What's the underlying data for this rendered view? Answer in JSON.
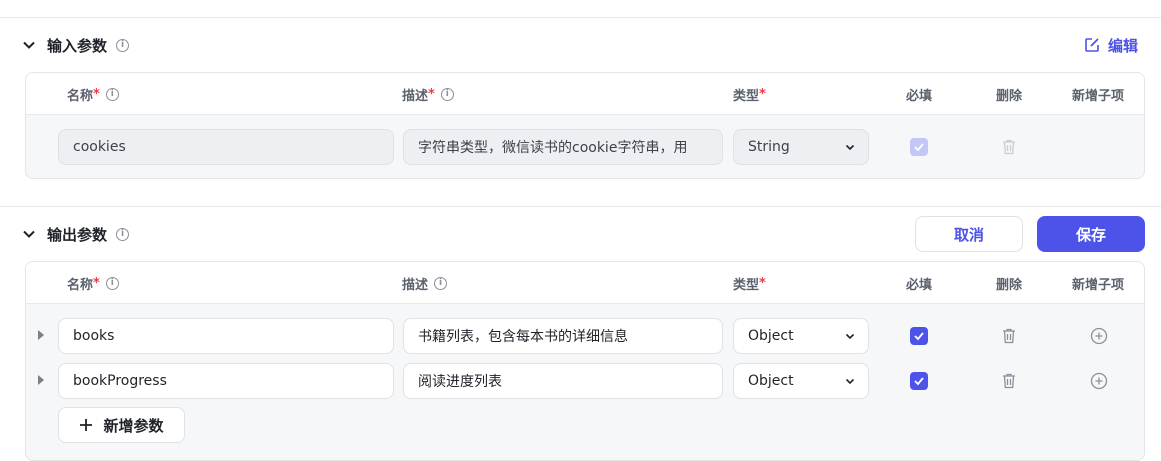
{
  "input_section": {
    "title": "输入参数",
    "edit_label": "编辑",
    "columns": {
      "name": "名称",
      "desc": "描述",
      "type": "类型",
      "required": "必填",
      "delete": "删除",
      "add_child": "新增子项",
      "required_mark": "*"
    },
    "rows": [
      {
        "name": "cookies",
        "desc": "字符串类型，微信读书的cookie字符串，用",
        "type": "String",
        "required": true
      }
    ]
  },
  "output_section": {
    "title": "输出参数",
    "cancel_label": "取消",
    "save_label": "保存",
    "columns": {
      "name": "名称",
      "desc": "描述",
      "type": "类型",
      "required": "必填",
      "delete": "删除",
      "add_child": "新增子项",
      "required_mark": "*"
    },
    "rows": [
      {
        "name": "books",
        "desc": "书籍列表，包含每本书的详细信息",
        "type": "Object",
        "required": true
      },
      {
        "name": "bookProgress",
        "desc": "阅读进度列表",
        "type": "Object",
        "required": true
      }
    ],
    "add_param_label": "新增参数"
  },
  "colors": {
    "accent": "#4d53e8",
    "required_star": "#f0394d"
  }
}
